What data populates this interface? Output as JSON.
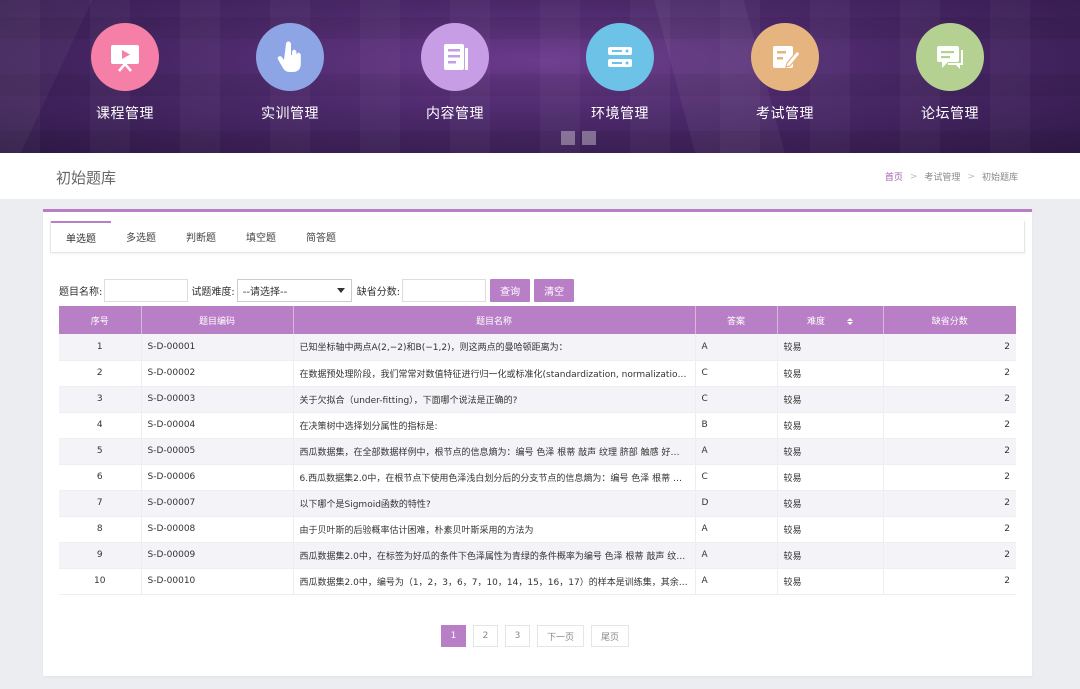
{
  "colors": {
    "accent": "#b97fc6",
    "banner_bg": "#4b2869",
    "nav_course": "#f57fa6",
    "nav_training": "#8ea5e5",
    "nav_content": "#c79ee6",
    "nav_env": "#6cc3e7",
    "nav_exam": "#e6b47e",
    "nav_forum": "#b5d191"
  },
  "nav": [
    {
      "label": "课程管理",
      "icon": "play-board-icon"
    },
    {
      "label": "实训管理",
      "icon": "hand-pointer-icon"
    },
    {
      "label": "内容管理",
      "icon": "document-list-icon"
    },
    {
      "label": "环境管理",
      "icon": "server-icon"
    },
    {
      "label": "考试管理",
      "icon": "edit-document-icon"
    },
    {
      "label": "论坛管理",
      "icon": "chat-bubble-icon"
    }
  ],
  "page_title": "初始题库",
  "breadcrumb": [
    "首页",
    "考试管理",
    "初始题库"
  ],
  "tabs": [
    "单选题",
    "多选题",
    "判断题",
    "填空题",
    "简答题"
  ],
  "search": {
    "name_label": "题目名称:",
    "name_value": "",
    "difficulty_label": "试题难度:",
    "difficulty_selected": "--请选择--",
    "score_label": "缺省分数:",
    "score_value": "",
    "query_button": "查询",
    "clear_button": "清空"
  },
  "table": {
    "headers": [
      "序号",
      "题目编码",
      "题目名称",
      "答案",
      "难度",
      "缺省分数"
    ],
    "rows": [
      [
        "1",
        "S-D-00001",
        "已知坐标轴中两点A(2,−2)和B(−1,2)，则这两点的曼哈顿距离为：",
        "A",
        "较易",
        "2"
      ],
      [
        "2",
        "S-D-00002",
        "在数据预处理阶段，我们常常对数值特征进行归一化或标准化(standardization, normalization)处理…",
        "C",
        "较易",
        "2"
      ],
      [
        "3",
        "S-D-00003",
        "关于欠拟合（under-fitting），下面哪个说法是正确的?",
        "C",
        "较易",
        "2"
      ],
      [
        "4",
        "S-D-00004",
        "在决策树中选择划分属性的指标是:",
        "B",
        "较易",
        "2"
      ],
      [
        "5",
        "S-D-00005",
        "西瓜数据集，在全部数据样例中，根节点的信息熵为：编号 色泽 根蒂 敲声 纹理 脐部 触感 好瓜…",
        "A",
        "较易",
        "2"
      ],
      [
        "6",
        "S-D-00006",
        "6.西瓜数据集2.0中，在根节点下使用色泽浅白划分后的分支节点的信息熵为：编号 色泽 根蒂 敲声…",
        "C",
        "较易",
        "2"
      ],
      [
        "7",
        "S-D-00007",
        "以下哪个是Sigmoid函数的特性?",
        "D",
        "较易",
        "2"
      ],
      [
        "8",
        "S-D-00008",
        "由于贝叶斯的后验概率估计困难，朴素贝叶斯采用的方法为",
        "A",
        "较易",
        "2"
      ],
      [
        "9",
        "S-D-00009",
        "西瓜数据集2.0中，在标签为好瓜的条件下色泽属性为青绿的条件概率为编号 色泽 根蒂 敲声 纹理…",
        "A",
        "较易",
        "2"
      ],
      [
        "10",
        "S-D-00010",
        "西瓜数据集2.0中，编号为（1，2，3，6，7，10，14，15，16，17）的样本是训练集，其余的样本…",
        "A",
        "较易",
        "2"
      ]
    ]
  },
  "pagination": {
    "pages": [
      "1",
      "2",
      "3"
    ],
    "current": "1",
    "next": "下一页",
    "last": "尾页"
  }
}
